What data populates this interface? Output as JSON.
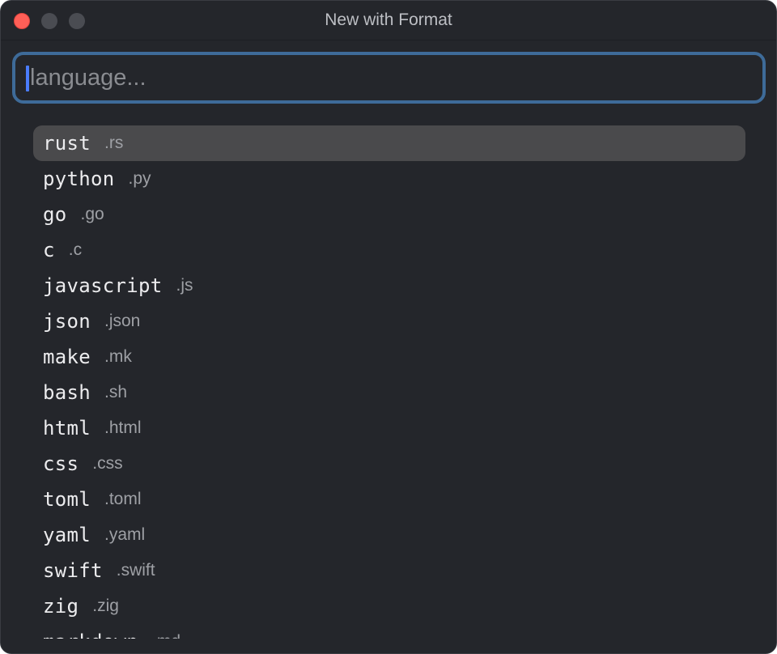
{
  "window": {
    "title": "New with Format"
  },
  "search": {
    "placeholder": "language...",
    "value": ""
  },
  "formats": [
    {
      "name": "rust",
      "ext": ".rs",
      "selected": true
    },
    {
      "name": "python",
      "ext": ".py"
    },
    {
      "name": "go",
      "ext": ".go"
    },
    {
      "name": "c",
      "ext": ".c"
    },
    {
      "name": "javascript",
      "ext": ".js"
    },
    {
      "name": "json",
      "ext": ".json"
    },
    {
      "name": "make",
      "ext": ".mk"
    },
    {
      "name": "bash",
      "ext": ".sh"
    },
    {
      "name": "html",
      "ext": ".html"
    },
    {
      "name": "css",
      "ext": ".css"
    },
    {
      "name": "toml",
      "ext": ".toml"
    },
    {
      "name": "yaml",
      "ext": ".yaml"
    },
    {
      "name": "swift",
      "ext": ".swift"
    },
    {
      "name": "zig",
      "ext": ".zig"
    },
    {
      "name": "markdown",
      "ext": ".md"
    }
  ],
  "colors": {
    "background": "#24262b",
    "focus_ring": "#3e6b99",
    "selection": "#4a4a4c",
    "close_button": "#ff5f57"
  }
}
